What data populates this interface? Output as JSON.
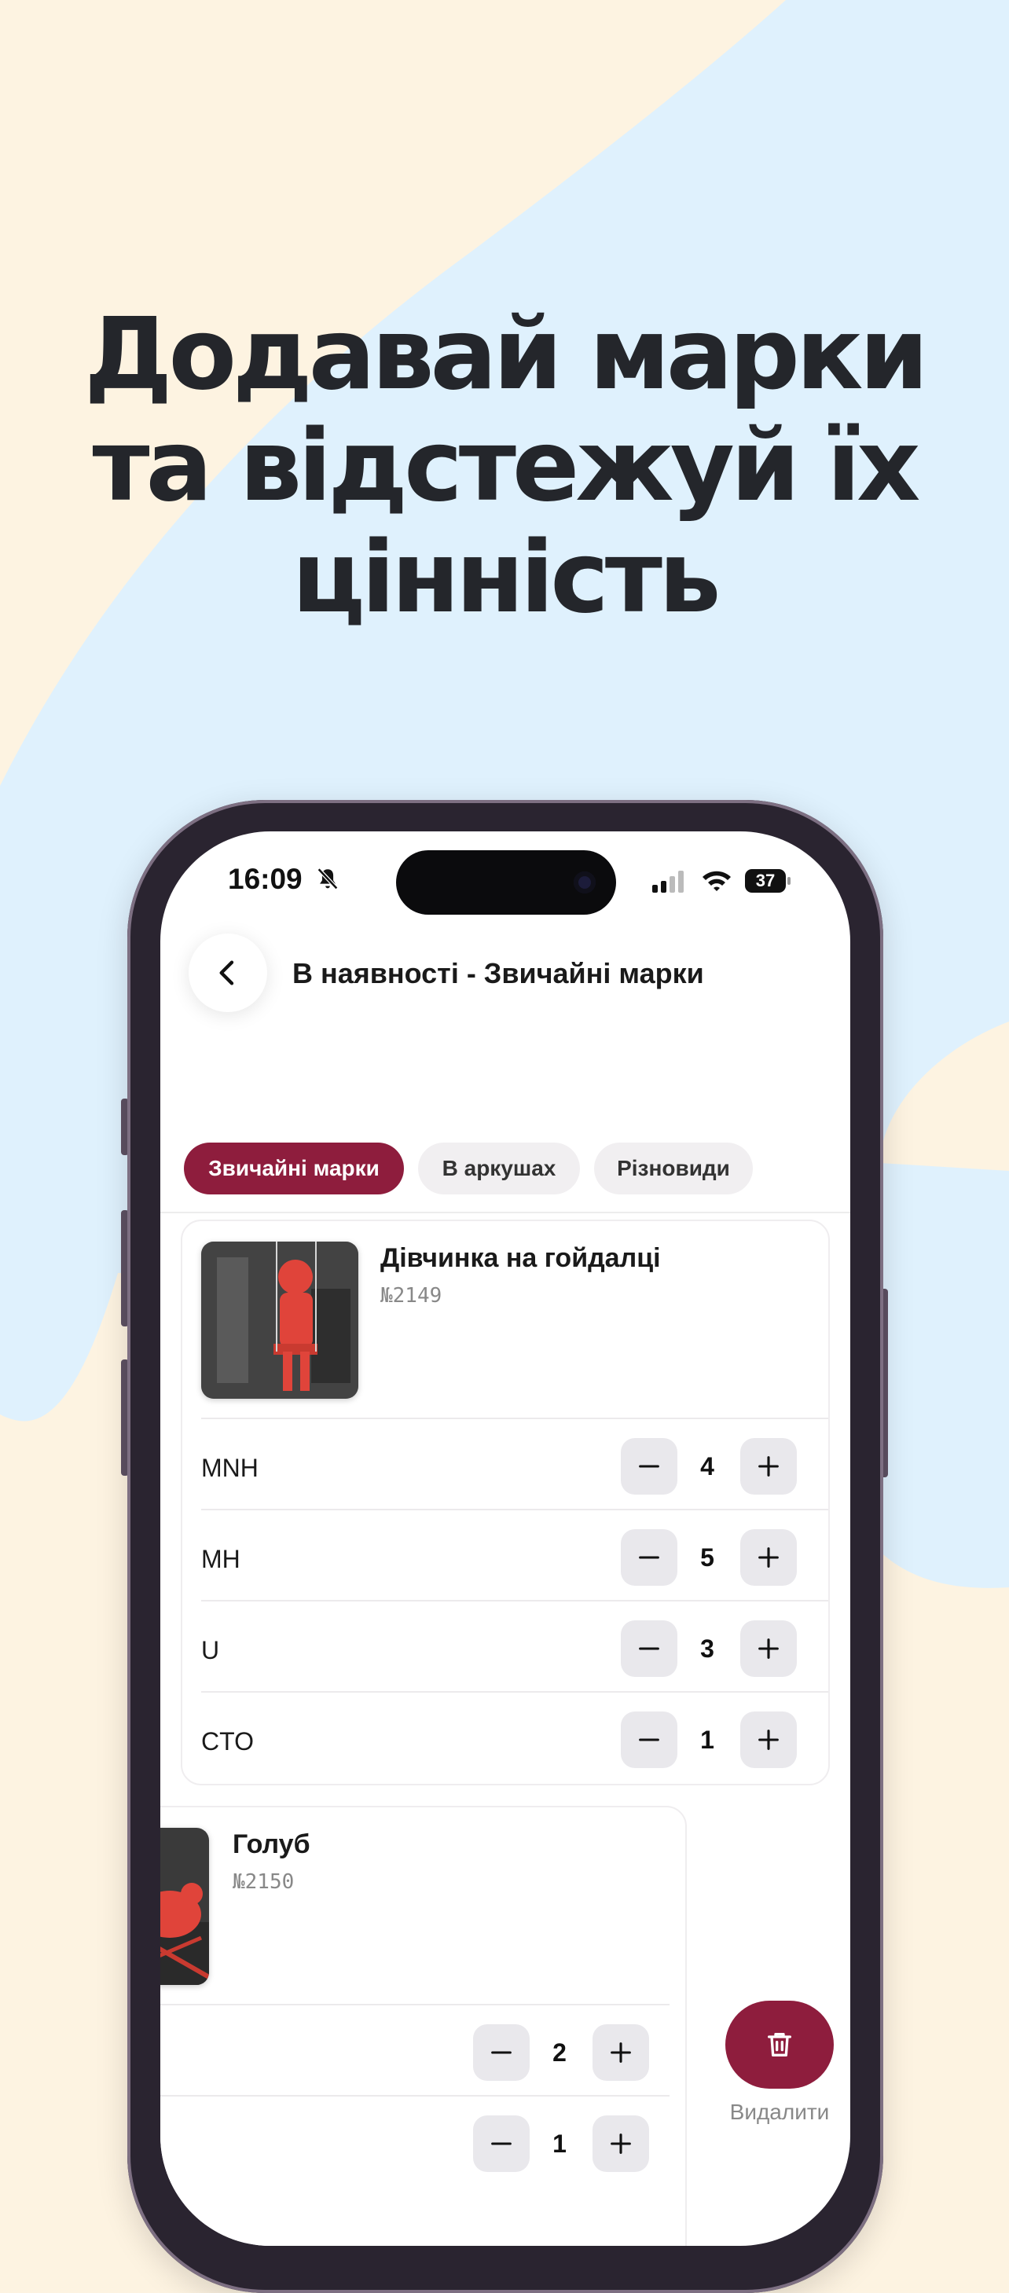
{
  "headline": [
    "Додавай марки",
    "та відстежуй їх",
    "цінність"
  ],
  "colors": {
    "accent": "#8e1d3d",
    "bg_cream": "#fdf3e1",
    "bg_blue": "#dff1fd"
  },
  "status_bar": {
    "time": "16:09",
    "battery": "37",
    "icons": [
      "bell-slash-icon",
      "signal-icon",
      "wifi-icon",
      "battery-icon"
    ]
  },
  "nav": {
    "title": "В наявності - Звичайні марки",
    "back_icon": "chevron-left-icon"
  },
  "tabs": [
    {
      "label": "Звичайні марки",
      "active": true
    },
    {
      "label": "В аркушах",
      "active": false
    },
    {
      "label": "Різновиди",
      "active": false
    }
  ],
  "stamps": [
    {
      "title": "Дівчинка на гойдалці",
      "number": "№2149",
      "rows": [
        {
          "label": "MNH",
          "qty": "4"
        },
        {
          "label": "MH",
          "qty": "5"
        },
        {
          "label": "U",
          "qty": "3"
        },
        {
          "label": "CTO",
          "qty": "1"
        }
      ]
    },
    {
      "title": "Голуб",
      "number": "№2150",
      "rows": [
        {
          "label": "",
          "qty": "2"
        },
        {
          "label": "",
          "qty": "1"
        }
      ]
    }
  ],
  "delete": {
    "label": "Видалити",
    "icon": "trash-icon"
  }
}
